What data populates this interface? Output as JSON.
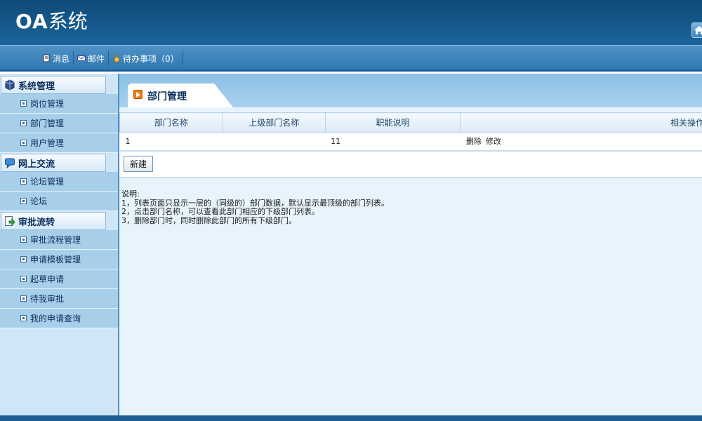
{
  "header": {
    "logo_latin": "OA",
    "logo_cjk": "系统"
  },
  "toolbar": {
    "items": [
      {
        "label": "消息",
        "icon": "message-icon"
      },
      {
        "label": "邮件",
        "icon": "mail-icon"
      },
      {
        "label": "待办事项（0）",
        "icon": "todo-hand-icon"
      }
    ]
  },
  "sidebar": {
    "groups": [
      {
        "label": "系统管理",
        "icon": "system-icon",
        "items": [
          "岗位管理",
          "部门管理",
          "用户管理"
        ]
      },
      {
        "label": "网上交流",
        "icon": "chat-icon",
        "items": [
          "论坛管理",
          "论坛"
        ]
      },
      {
        "label": "审批流转",
        "icon": "approval-icon",
        "items": [
          "审批流程管理",
          "申请模板管理",
          "起草申请",
          "待我审批",
          "我的申请查询"
        ]
      }
    ]
  },
  "main": {
    "tab_title": "部门管理",
    "table": {
      "headers": [
        "部门名称",
        "上级部门名称",
        "职能说明",
        "相关操作"
      ],
      "rows": [
        {
          "name": "1",
          "parent": "",
          "desc": "11",
          "op_delete": "删除",
          "op_edit": "修改"
        }
      ]
    },
    "new_button": "新建",
    "notes": [
      "说明:",
      "1，列表页面只显示一层的（同级的）部门数据，默认显示最顶级的部门列表。",
      "2，点击部门名称，可以查看此部门相应的下级部门列表。",
      "3，删除部门时，同时删除此部门的所有下级部门。"
    ]
  },
  "colors": {
    "header": "#15588c",
    "toolbar": "#2f78b2",
    "sidebar": "#a7cfea",
    "accent": "#f07b10"
  }
}
